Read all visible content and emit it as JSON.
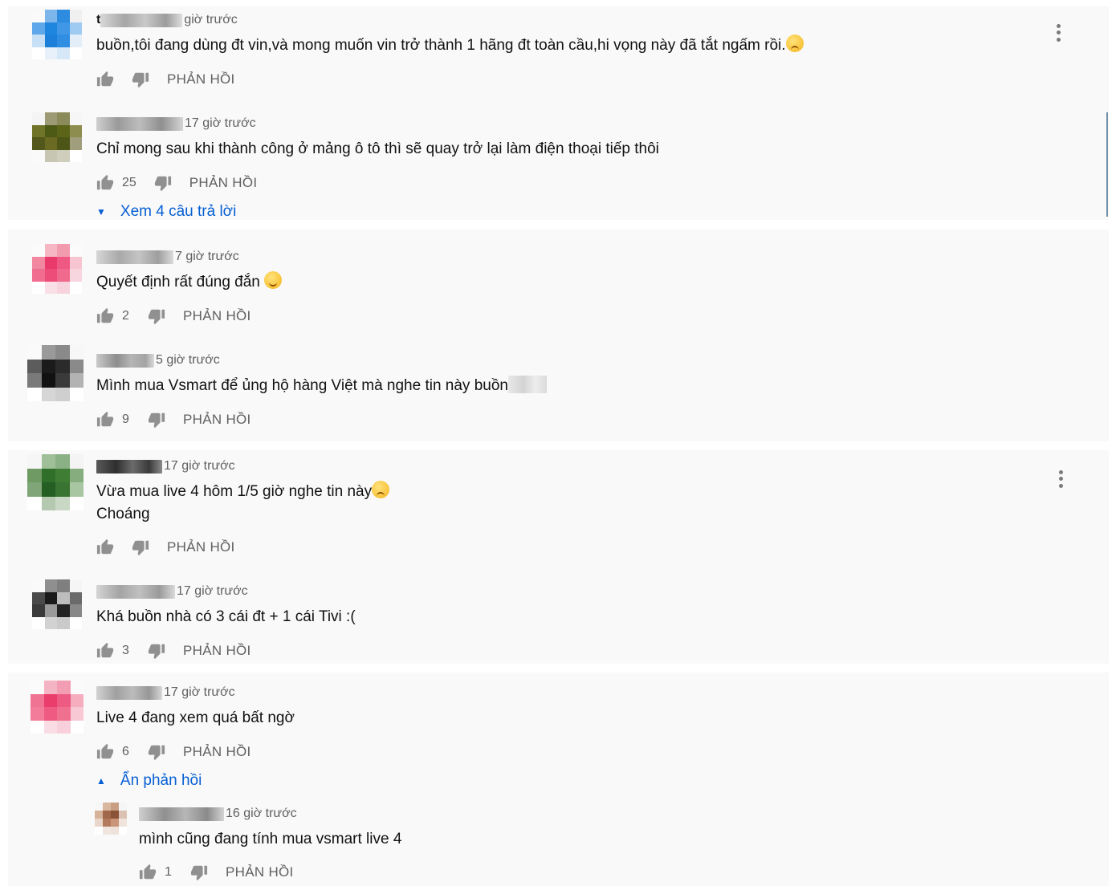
{
  "labels": {
    "reply": "PHẢN HỒI"
  },
  "colors": {
    "link": "#065fd4",
    "meta": "#606060",
    "panel": "#f9f9f9"
  },
  "icons": {
    "like": "thumb-up-icon",
    "dislike": "thumb-down-icon",
    "menu": "more-vert-icon"
  },
  "comments": [
    {
      "author_initial": "t",
      "time": "giờ trước",
      "text": "buồn,tôi đang dùng đt vin,và mong muốn vin trở thành 1 hãng đt toàn cầu,hi vọng này đã tắt ngấm rồi.",
      "likes": ""
    },
    {
      "time": "17 giờ trước",
      "text": "Chỉ mong sau khi thành công ở mảng ô tô thì sẽ quay trở lại làm điện thoại tiếp thôi",
      "likes": "25",
      "view_replies": "Xem 4 câu trả lời"
    },
    {
      "time": "7 giờ trước",
      "text": "Quyết định rất đúng đắn",
      "likes": "2"
    },
    {
      "time": "5 giờ trước",
      "text": "Mình mua Vsmart để ủng hộ hàng Việt mà nghe tin này buồn",
      "likes": "9"
    },
    {
      "time": "17 giờ trước",
      "text": "Vừa mua live 4 hôm 1/5 giờ nghe tin này",
      "text_line2": "Choáng",
      "likes": ""
    },
    {
      "time": "17 giờ trước",
      "text": "Khá buồn nhà có 3 cái đt + 1 cái Tivi :(",
      "likes": "3"
    },
    {
      "time": "17 giờ trước",
      "text": "Live 4 đang xem quá bất ngờ",
      "likes": "6",
      "hide_replies": "Ẩn phản hồi"
    },
    {
      "time": "16 giờ trước",
      "text": "mình cũng đang tính mua vsmart live 4",
      "likes": "1"
    }
  ]
}
